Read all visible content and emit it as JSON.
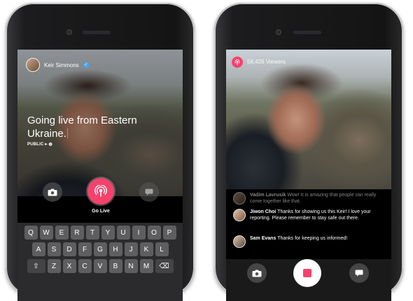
{
  "left_phone": {
    "broadcaster_name": "Keir Simmons",
    "headline": "Going live from Eastern Ukraine.",
    "privacy": "PUBLIC ▸ ◍",
    "go_live_label": "Go Live",
    "keyboard_rows": [
      [
        "Q",
        "W",
        "E",
        "R",
        "T",
        "Y",
        "U",
        "I",
        "O",
        "P"
      ],
      [
        "A",
        "S",
        "D",
        "F",
        "G",
        "H",
        "J",
        "K",
        "L"
      ],
      [
        "⇧",
        "Z",
        "X",
        "C",
        "V",
        "B",
        "N",
        "M",
        "⌫"
      ]
    ]
  },
  "right_phone": {
    "viewers": "58,426 Viewers",
    "comments": [
      {
        "name": "Vadim Lavrusik",
        "text": "Wow! It is amazing that people can really come together like that."
      },
      {
        "name": "Jiwon Choi",
        "text": "Thanks for showing us this Keir! I love your reporting. Please remember to stay safe out there."
      },
      {
        "name": "Sam Evans",
        "text": "Thanks for keeping us informed!"
      }
    ]
  },
  "colors": {
    "accent": "#f5426c",
    "verified": "#4aa3ff"
  },
  "icons": [
    "camera-icon",
    "live-broadcast-icon",
    "chat-icon",
    "stop-icon",
    "verified-icon",
    "shift-icon",
    "backspace-icon"
  ]
}
